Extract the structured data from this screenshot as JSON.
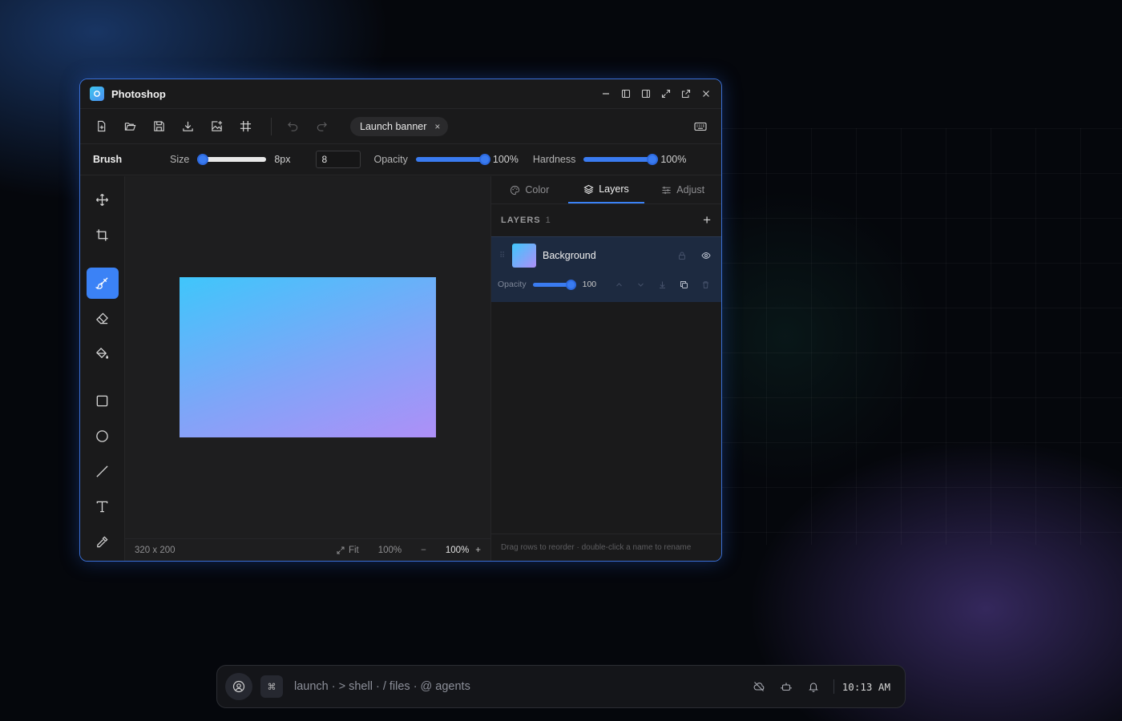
{
  "window": {
    "app_title": "Photoshop"
  },
  "toolbar": {
    "document_tab": "Launch banner",
    "document_tab_close": "×"
  },
  "options": {
    "tool_name": "Brush",
    "size_label": "Size",
    "size_value": "8px",
    "size_fraction": 0.08,
    "size_input": "8",
    "opacity_label": "Opacity",
    "opacity_value": "100%",
    "opacity_fraction": 1.0,
    "hardness_label": "Hardness",
    "hardness_value": "100%",
    "hardness_fraction": 1.0
  },
  "tools": [
    "move-icon",
    "crop-icon",
    "brush-icon",
    "eraser-icon",
    "fill-icon",
    "rectangle-icon",
    "ellipse-icon",
    "line-icon",
    "text-icon",
    "eyedropper-icon"
  ],
  "active_tool": "brush-icon",
  "canvas": {
    "dimensions": "320 x 200",
    "fit_label": "Fit",
    "zoom_preset": "100%",
    "zoom_minus": "−",
    "zoom_value": "100%",
    "zoom_plus": "+",
    "gradient_colors": [
      "#3fc6fb",
      "#7fa5f8",
      "#ae8ff7"
    ]
  },
  "panel": {
    "tabs": [
      {
        "label": "Color",
        "icon": "palette-icon"
      },
      {
        "label": "Layers",
        "icon": "layers-icon",
        "active": true
      },
      {
        "label": "Adjust",
        "icon": "sliders-icon"
      }
    ],
    "layers_title": "LAYERS",
    "layers_count": "1",
    "add_label": "+",
    "layer": {
      "name": "Background",
      "opacity_label": "Opacity",
      "opacity_value": "100",
      "opacity_fraction": 1.0
    },
    "footer_hint": "Drag rows to reorder · double-click a name to rename"
  },
  "taskbar": {
    "cmd_key": "⌘",
    "launcher_text": "launch · > shell · / files · @ agents",
    "time": "10:13 AM"
  },
  "colors": {
    "accent": "#3b82f6",
    "window_border": "#3a6fd4"
  }
}
